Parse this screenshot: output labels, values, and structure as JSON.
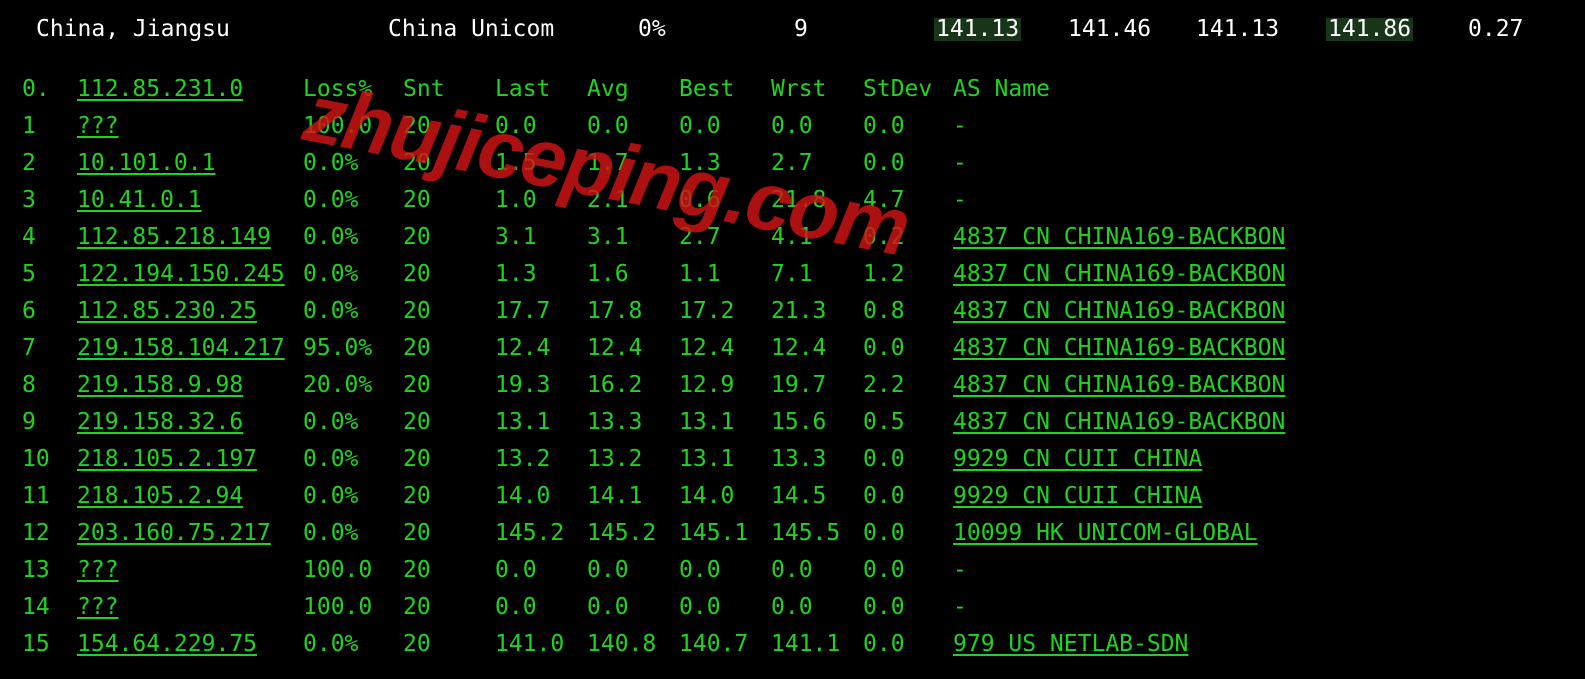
{
  "watermark_text": "zhujiceping.com",
  "summary": {
    "location": "China, Jiangsu",
    "isp": "China Unicom",
    "loss": "0%",
    "hops": "9",
    "v1": "141.13",
    "v2": "141.46",
    "v3": "141.13",
    "v4": "141.86",
    "v5": "0.27"
  },
  "headers": {
    "hop": "0.",
    "host": "112.85.231.0",
    "loss": "Loss%",
    "snt": "Snt",
    "last": "Last",
    "avg": "Avg",
    "best": "Best",
    "wrst": "Wrst",
    "stdev": "StDev",
    "asname": "AS Name"
  },
  "hops": [
    {
      "n": "1",
      "host": "???",
      "loss": "100.0",
      "snt": "20",
      "last": "0.0",
      "avg": "0.0",
      "best": "0.0",
      "wrst": "0.0",
      "stdev": "0.0",
      "asname": "-"
    },
    {
      "n": "2",
      "host": "10.101.0.1",
      "loss": "0.0%",
      "snt": "20",
      "last": "1.5",
      "avg": "1.7",
      "best": "1.3",
      "wrst": "2.7",
      "stdev": "0.0",
      "asname": "-"
    },
    {
      "n": "3",
      "host": "10.41.0.1",
      "loss": "0.0%",
      "snt": "20",
      "last": "1.0",
      "avg": "2.1",
      "best": "0.6",
      "wrst": "21.8",
      "stdev": "4.7",
      "asname": "-"
    },
    {
      "n": "4",
      "host": "112.85.218.149",
      "loss": "0.0%",
      "snt": "20",
      "last": "3.1",
      "avg": "3.1",
      "best": "2.7",
      "wrst": "4.1",
      "stdev": "0.2",
      "asname": "4837   CN CHINA169-BACKBON"
    },
    {
      "n": "5",
      "host": "122.194.150.245",
      "loss": "0.0%",
      "snt": "20",
      "last": "1.3",
      "avg": "1.6",
      "best": "1.1",
      "wrst": "7.1",
      "stdev": "1.2",
      "asname": "4837   CN CHINA169-BACKBON"
    },
    {
      "n": "6",
      "host": "112.85.230.25",
      "loss": "0.0%",
      "snt": "20",
      "last": "17.7",
      "avg": "17.8",
      "best": "17.2",
      "wrst": "21.3",
      "stdev": "0.8",
      "asname": "4837   CN CHINA169-BACKBON"
    },
    {
      "n": "7",
      "host": "219.158.104.217",
      "loss": "95.0%",
      "snt": "20",
      "last": "12.4",
      "avg": "12.4",
      "best": "12.4",
      "wrst": "12.4",
      "stdev": "0.0",
      "asname": "4837   CN CHINA169-BACKBON"
    },
    {
      "n": "8",
      "host": "219.158.9.98",
      "loss": "20.0%",
      "snt": "20",
      "last": "19.3",
      "avg": "16.2",
      "best": "12.9",
      "wrst": "19.7",
      "stdev": "2.2",
      "asname": "4837   CN CHINA169-BACKBON"
    },
    {
      "n": "9",
      "host": "219.158.32.6",
      "loss": "0.0%",
      "snt": "20",
      "last": "13.1",
      "avg": "13.3",
      "best": "13.1",
      "wrst": "15.6",
      "stdev": "0.5",
      "asname": "4837   CN CHINA169-BACKBON"
    },
    {
      "n": "10",
      "host": "218.105.2.197",
      "loss": "0.0%",
      "snt": "20",
      "last": "13.2",
      "avg": "13.2",
      "best": "13.1",
      "wrst": "13.3",
      "stdev": "0.0",
      "asname": "9929   CN CUII  CHINA"
    },
    {
      "n": "11",
      "host": "218.105.2.94",
      "loss": "0.0%",
      "snt": "20",
      "last": "14.0",
      "avg": "14.1",
      "best": "14.0",
      "wrst": "14.5",
      "stdev": "0.0",
      "asname": "9929   CN CUII  CHINA"
    },
    {
      "n": "12",
      "host": "203.160.75.217",
      "loss": "0.0%",
      "snt": "20",
      "last": "145.2",
      "avg": "145.2",
      "best": "145.1",
      "wrst": "145.5",
      "stdev": "0.0",
      "asname": "10099  HK UNICOM-GLOBAL"
    },
    {
      "n": "13",
      "host": "???",
      "loss": "100.0",
      "snt": "20",
      "last": "0.0",
      "avg": "0.0",
      "best": "0.0",
      "wrst": "0.0",
      "stdev": "0.0",
      "asname": "-"
    },
    {
      "n": "14",
      "host": "???",
      "loss": "100.0",
      "snt": "20",
      "last": "0.0",
      "avg": "0.0",
      "best": "0.0",
      "wrst": "0.0",
      "stdev": "0.0",
      "asname": "-"
    },
    {
      "n": "15",
      "host": "154.64.229.75",
      "loss": "0.0%",
      "snt": "20",
      "last": "141.0",
      "avg": "140.8",
      "best": "140.7",
      "wrst": "141.1",
      "stdev": "0.0",
      "asname": "979    US NETLAB-SDN"
    }
  ]
}
